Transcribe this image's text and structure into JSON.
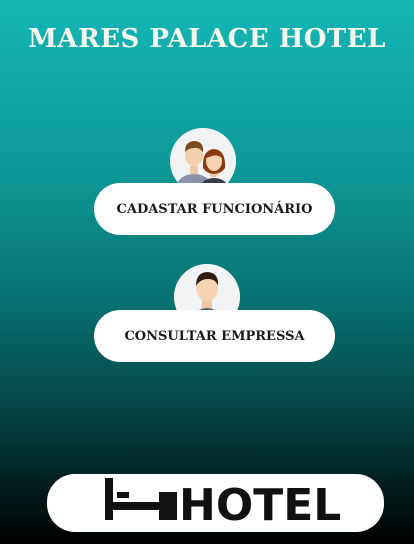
{
  "app": {
    "title": "MARES PALACE HOTEL"
  },
  "actions": [
    {
      "label": "CADASTAR FUNCIONÁRIO",
      "icon": "employees-icon"
    },
    {
      "label": "CONSULTAR EMPRESSA",
      "icon": "businessman-icon"
    }
  ],
  "logo": {
    "text": "HOTEL",
    "icon": "hotel-bed-logo"
  },
  "colors": {
    "background_top": "#14b6b6",
    "background_bottom": "#000000",
    "button_bg": "#ffffff",
    "title_text": "#f4f7ee"
  }
}
